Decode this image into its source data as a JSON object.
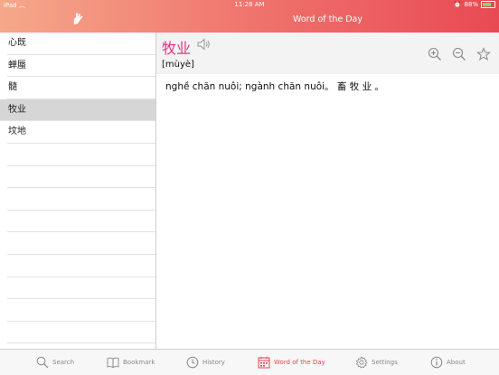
{
  "status_bar": {
    "device": "iPad",
    "time": "11:28 AM",
    "battery": "88%"
  },
  "header": {
    "title": "Word of the Day"
  },
  "sidebar": {
    "items": [
      {
        "label": "心既"
      },
      {
        "label": "蝉蜃"
      },
      {
        "label": "髓"
      },
      {
        "label": "牧业"
      },
      {
        "label": "坟地"
      },
      {
        "label": ""
      },
      {
        "label": ""
      },
      {
        "label": ""
      },
      {
        "label": ""
      },
      {
        "label": ""
      },
      {
        "label": ""
      },
      {
        "label": ""
      },
      {
        "label": ""
      },
      {
        "label": ""
      }
    ],
    "selected_index": 3
  },
  "entry": {
    "word": "牧业",
    "pinyin": "[mùyè]",
    "meaning": "nghề chăn nuôi; ngành chăn nuôi。 畜 牧 业 。"
  },
  "toolbar": {
    "icons": [
      "zoom-in-icon",
      "zoom-out-icon",
      "star-icon"
    ]
  },
  "tabbar": {
    "tabs": [
      {
        "label": "Search",
        "icon": "search-icon"
      },
      {
        "label": "Bookmark",
        "icon": "book-icon"
      },
      {
        "label": "History",
        "icon": "clock-icon"
      },
      {
        "label": "Word of the Day",
        "icon": "calendar-icon",
        "active": true
      },
      {
        "label": "Settings",
        "icon": "gear-icon"
      },
      {
        "label": "About",
        "icon": "info-icon"
      }
    ]
  },
  "colors": {
    "accent": "#e8424f",
    "word": "#e6317f",
    "header_start": "#f5a88a",
    "header_end": "#e84a52"
  }
}
